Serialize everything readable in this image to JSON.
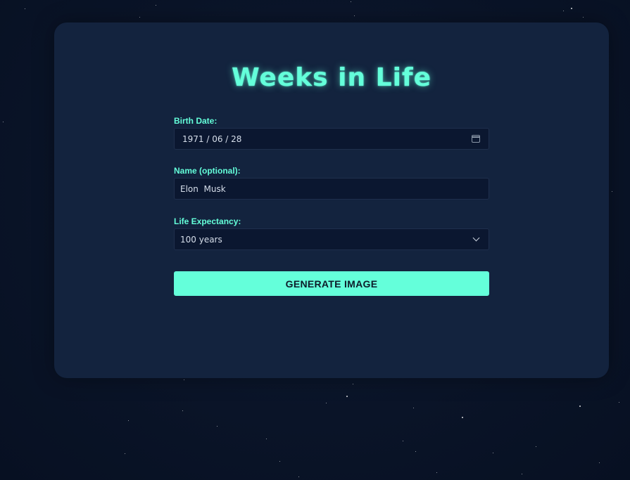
{
  "app": {
    "title": "Weeks in Life"
  },
  "form": {
    "birth_date": {
      "label": "Birth Date:",
      "value": "1971 / 06 / 28"
    },
    "name": {
      "label": "Name (optional):",
      "value": "Elon  Musk"
    },
    "life_expectancy": {
      "label": "Life Expectancy:",
      "selected": "100 years"
    },
    "submit_label": "GENERATE IMAGE"
  },
  "icons": {
    "date_picker": "calendar-icon",
    "select_arrow": "chevron-down-icon"
  },
  "colors": {
    "accent": "#64ffda",
    "card": "#13233e",
    "background": "#0a1428",
    "input": "#0b1730"
  }
}
